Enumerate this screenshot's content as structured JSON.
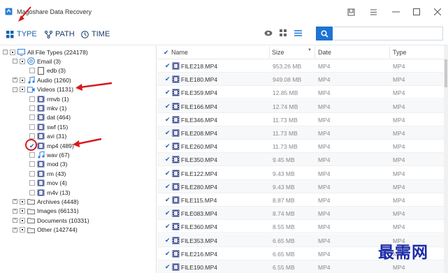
{
  "app": {
    "title": "Magoshare Data Recovery"
  },
  "tabs": [
    {
      "label": "TYPE",
      "icon": "grid-icon",
      "active": true
    },
    {
      "label": "PATH",
      "icon": "path-icon",
      "active": false
    },
    {
      "label": "TIME",
      "icon": "clock-icon",
      "active": false
    }
  ],
  "search": {
    "placeholder": ""
  },
  "tree": [
    {
      "label": "All File Types (224178)",
      "icon": "monitor-icon",
      "expander": "-"
    },
    {
      "label": "Email (3)",
      "icon": "email-icon",
      "expander": "-"
    },
    {
      "label": "edb (3)",
      "icon": "document-icon",
      "expander": ""
    },
    {
      "label": "Audio (1260)",
      "icon": "music-icon",
      "expander": "+"
    },
    {
      "label": "Videos (1131)",
      "icon": "video-icon",
      "expander": "-"
    },
    {
      "label": "rmvb (1)",
      "icon": "film-icon",
      "expander": ""
    },
    {
      "label": "mkv (1)",
      "icon": "film-icon",
      "expander": ""
    },
    {
      "label": "dat (464)",
      "icon": "film-icon",
      "expander": ""
    },
    {
      "label": "swf (15)",
      "icon": "film-icon",
      "expander": ""
    },
    {
      "label": "avi (31)",
      "icon": "film-icon",
      "expander": ""
    },
    {
      "label": "mp4 (489)",
      "icon": "film-icon",
      "expander": "",
      "checked": true
    },
    {
      "label": "wav (67)",
      "icon": "music-icon",
      "expander": ""
    },
    {
      "label": "mod (3)",
      "icon": "film-icon",
      "expander": ""
    },
    {
      "label": "rm (43)",
      "icon": "film-icon",
      "expander": ""
    },
    {
      "label": "mov (4)",
      "icon": "film-icon",
      "expander": ""
    },
    {
      "label": "m4v (13)",
      "icon": "film-icon",
      "expander": ""
    },
    {
      "label": "Archives (4448)",
      "icon": "folder-icon",
      "expander": "+"
    },
    {
      "label": "Images (66131)",
      "icon": "folder-icon",
      "expander": "+"
    },
    {
      "label": "Documents (10331)",
      "icon": "folder-icon",
      "expander": "+"
    },
    {
      "label": "Other (142744)",
      "icon": "folder-icon",
      "expander": "+"
    }
  ],
  "columns": {
    "name": "Name",
    "size": "Size",
    "date": "Date",
    "type": "Type"
  },
  "files": [
    {
      "name": "FILE218.MP4",
      "size": "953.26 MB",
      "date": "MP4",
      "type": "MP4"
    },
    {
      "name": "FILE180.MP4",
      "size": "949.08 MB",
      "date": "MP4",
      "type": "MP4"
    },
    {
      "name": "FILE359.MP4",
      "size": "12.85 MB",
      "date": "MP4",
      "type": "MP4"
    },
    {
      "name": "FILE166.MP4",
      "size": "12.74 MB",
      "date": "MP4",
      "type": "MP4"
    },
    {
      "name": "FILE346.MP4",
      "size": "11.73 MB",
      "date": "MP4",
      "type": "MP4"
    },
    {
      "name": "FILE208.MP4",
      "size": "11.73 MB",
      "date": "MP4",
      "type": "MP4"
    },
    {
      "name": "FILE260.MP4",
      "size": "11.73 MB",
      "date": "MP4",
      "type": "MP4"
    },
    {
      "name": "FILE350.MP4",
      "size": "9.45 MB",
      "date": "MP4",
      "type": "MP4"
    },
    {
      "name": "FILE122.MP4",
      "size": "9.43 MB",
      "date": "MP4",
      "type": "MP4"
    },
    {
      "name": "FILE280.MP4",
      "size": "9.43 MB",
      "date": "MP4",
      "type": "MP4"
    },
    {
      "name": "FILE115.MP4",
      "size": "8.87 MB",
      "date": "MP4",
      "type": "MP4"
    },
    {
      "name": "FILE083.MP4",
      "size": "8.74 MB",
      "date": "MP4",
      "type": "MP4"
    },
    {
      "name": "FILE360.MP4",
      "size": "8.55 MB",
      "date": "MP4",
      "type": "MP4"
    },
    {
      "name": "FILE353.MP4",
      "size": "6.65 MB",
      "date": "MP4",
      "type": "MP4"
    },
    {
      "name": "FILE216.MP4",
      "size": "6.65 MB",
      "date": "MP4",
      "type": "MP4"
    },
    {
      "name": "FILE190.MP4",
      "size": "6.55 MB",
      "date": "MP4",
      "type": "MP4"
    }
  ],
  "watermark": "最需网",
  "colors": {
    "accent": "#1f74d2",
    "annotation": "#d9191c",
    "watermark": "#1c2ba8"
  }
}
